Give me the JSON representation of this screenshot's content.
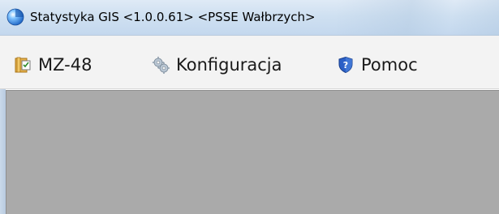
{
  "window": {
    "title": "Statystyka GIS <1.0.0.61> <PSSE Wałbrzych>",
    "app_icon": "blue-sphere-icon"
  },
  "menu": {
    "items": [
      {
        "label": "MZ-48",
        "icon": "folder-checklist-icon"
      },
      {
        "label": "Konfiguracja",
        "icon": "gears-icon"
      },
      {
        "label": "Pomoc",
        "icon": "help-shield-icon"
      }
    ]
  },
  "colors": {
    "titlebar": "#cfe0f1",
    "menubar": "#f3f3f3",
    "client_area": "#aaaaaa",
    "help_icon_blue": "#2b5fc6"
  }
}
